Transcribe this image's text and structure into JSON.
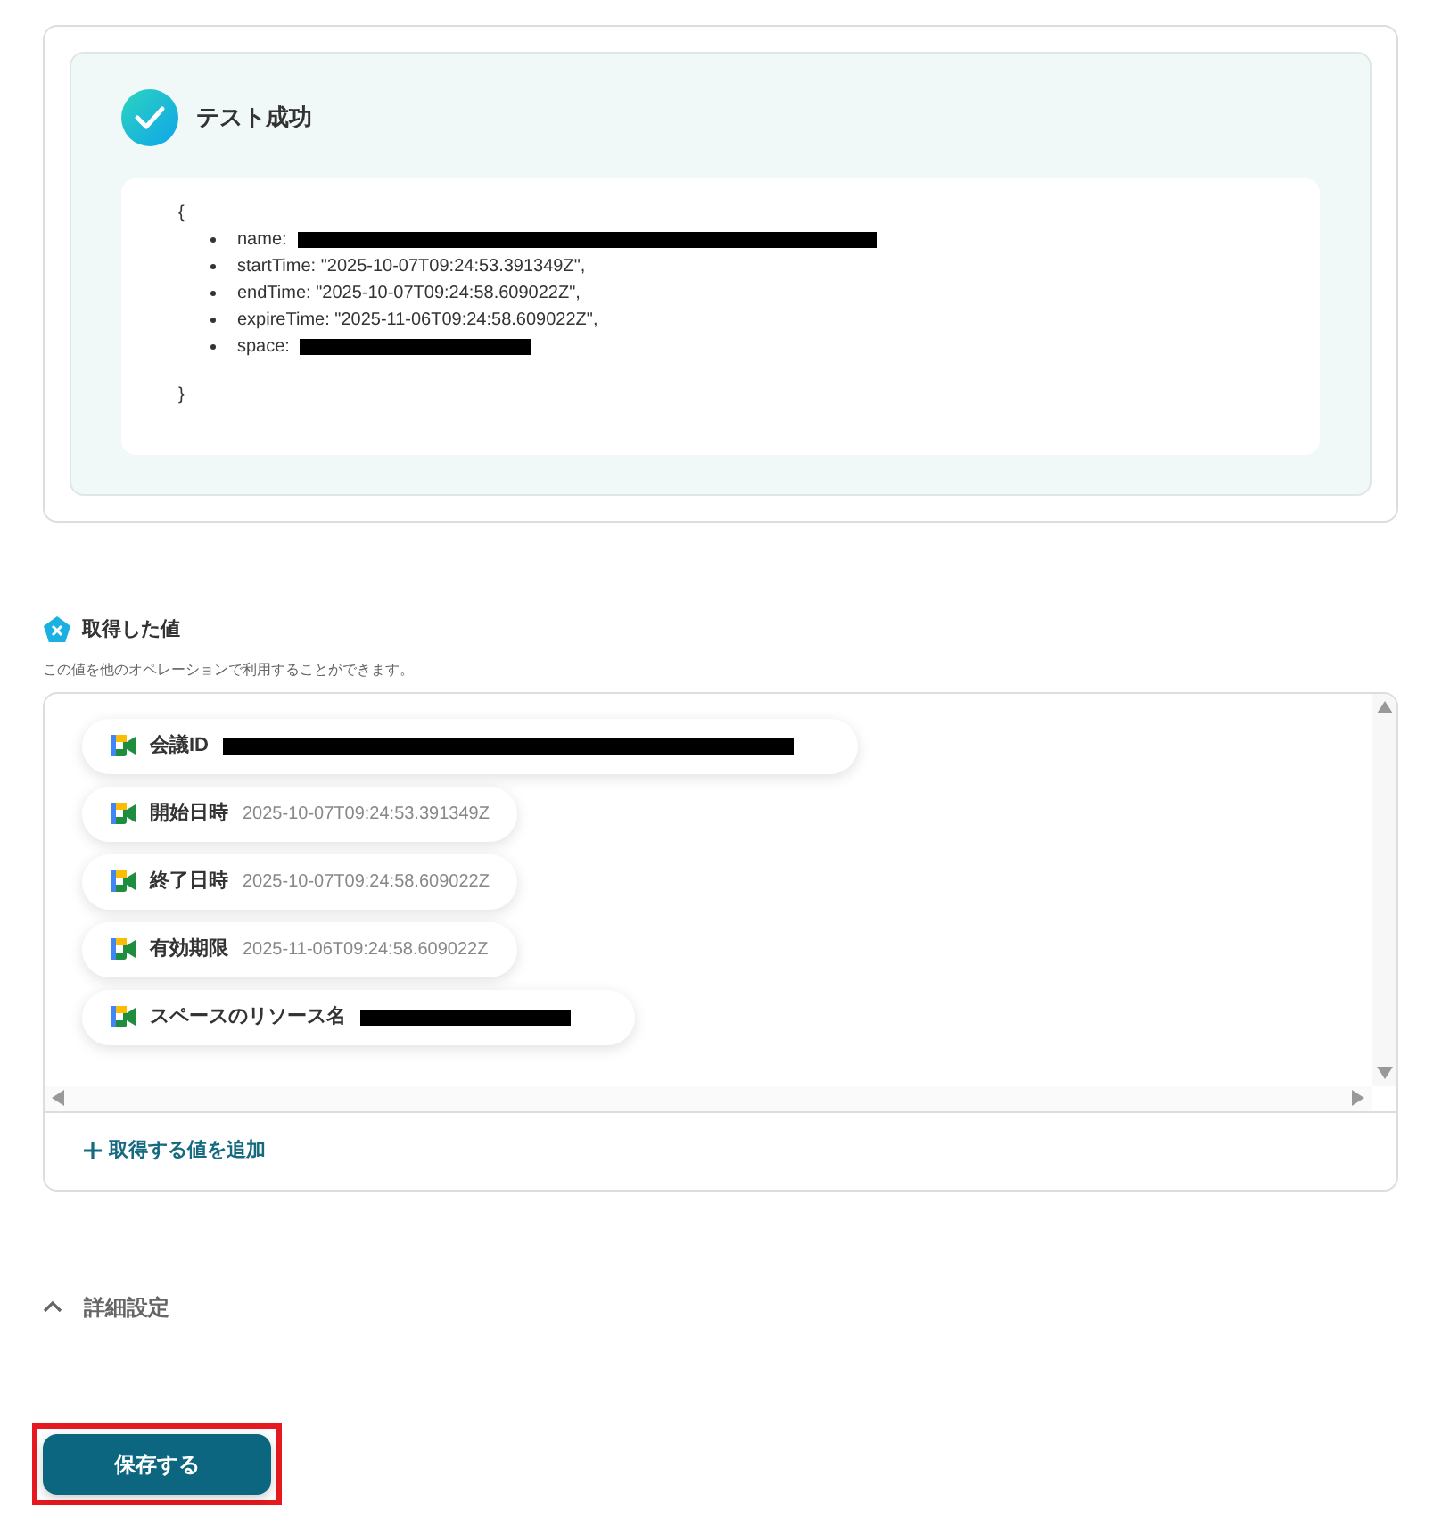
{
  "test_result": {
    "title": "テスト成功",
    "open_brace": "{",
    "close_brace": "}",
    "lines": [
      {
        "kind": "redacted",
        "text": "name:"
      },
      {
        "kind": "plain",
        "text": "startTime: \"2025-10-07T09:24:53.391349Z\","
      },
      {
        "kind": "plain",
        "text": "endTime: \"2025-10-07T09:24:58.609022Z\","
      },
      {
        "kind": "plain",
        "text": "expireTime: \"2025-11-06T09:24:58.609022Z\","
      },
      {
        "kind": "redacted",
        "text": "space:"
      }
    ]
  },
  "values_section": {
    "title": "取得した値",
    "description": "この値を他のオペレーションで利用することができます。",
    "items": [
      {
        "label": "会議ID",
        "kind": "redacted"
      },
      {
        "label": "開始日時",
        "kind": "plain",
        "value": "2025-10-07T09:24:53.391349Z"
      },
      {
        "label": "終了日時",
        "kind": "plain",
        "value": "2025-10-07T09:24:58.609022Z"
      },
      {
        "label": "有効期限",
        "kind": "plain",
        "value": "2025-11-06T09:24:58.609022Z"
      },
      {
        "label": "スペースのリソース名",
        "kind": "redacted"
      }
    ],
    "add_link": "取得する値を追加"
  },
  "advanced": {
    "label": "詳細設定",
    "expanded": true
  },
  "save_button": {
    "label": "保存する",
    "highlighted": true
  }
}
